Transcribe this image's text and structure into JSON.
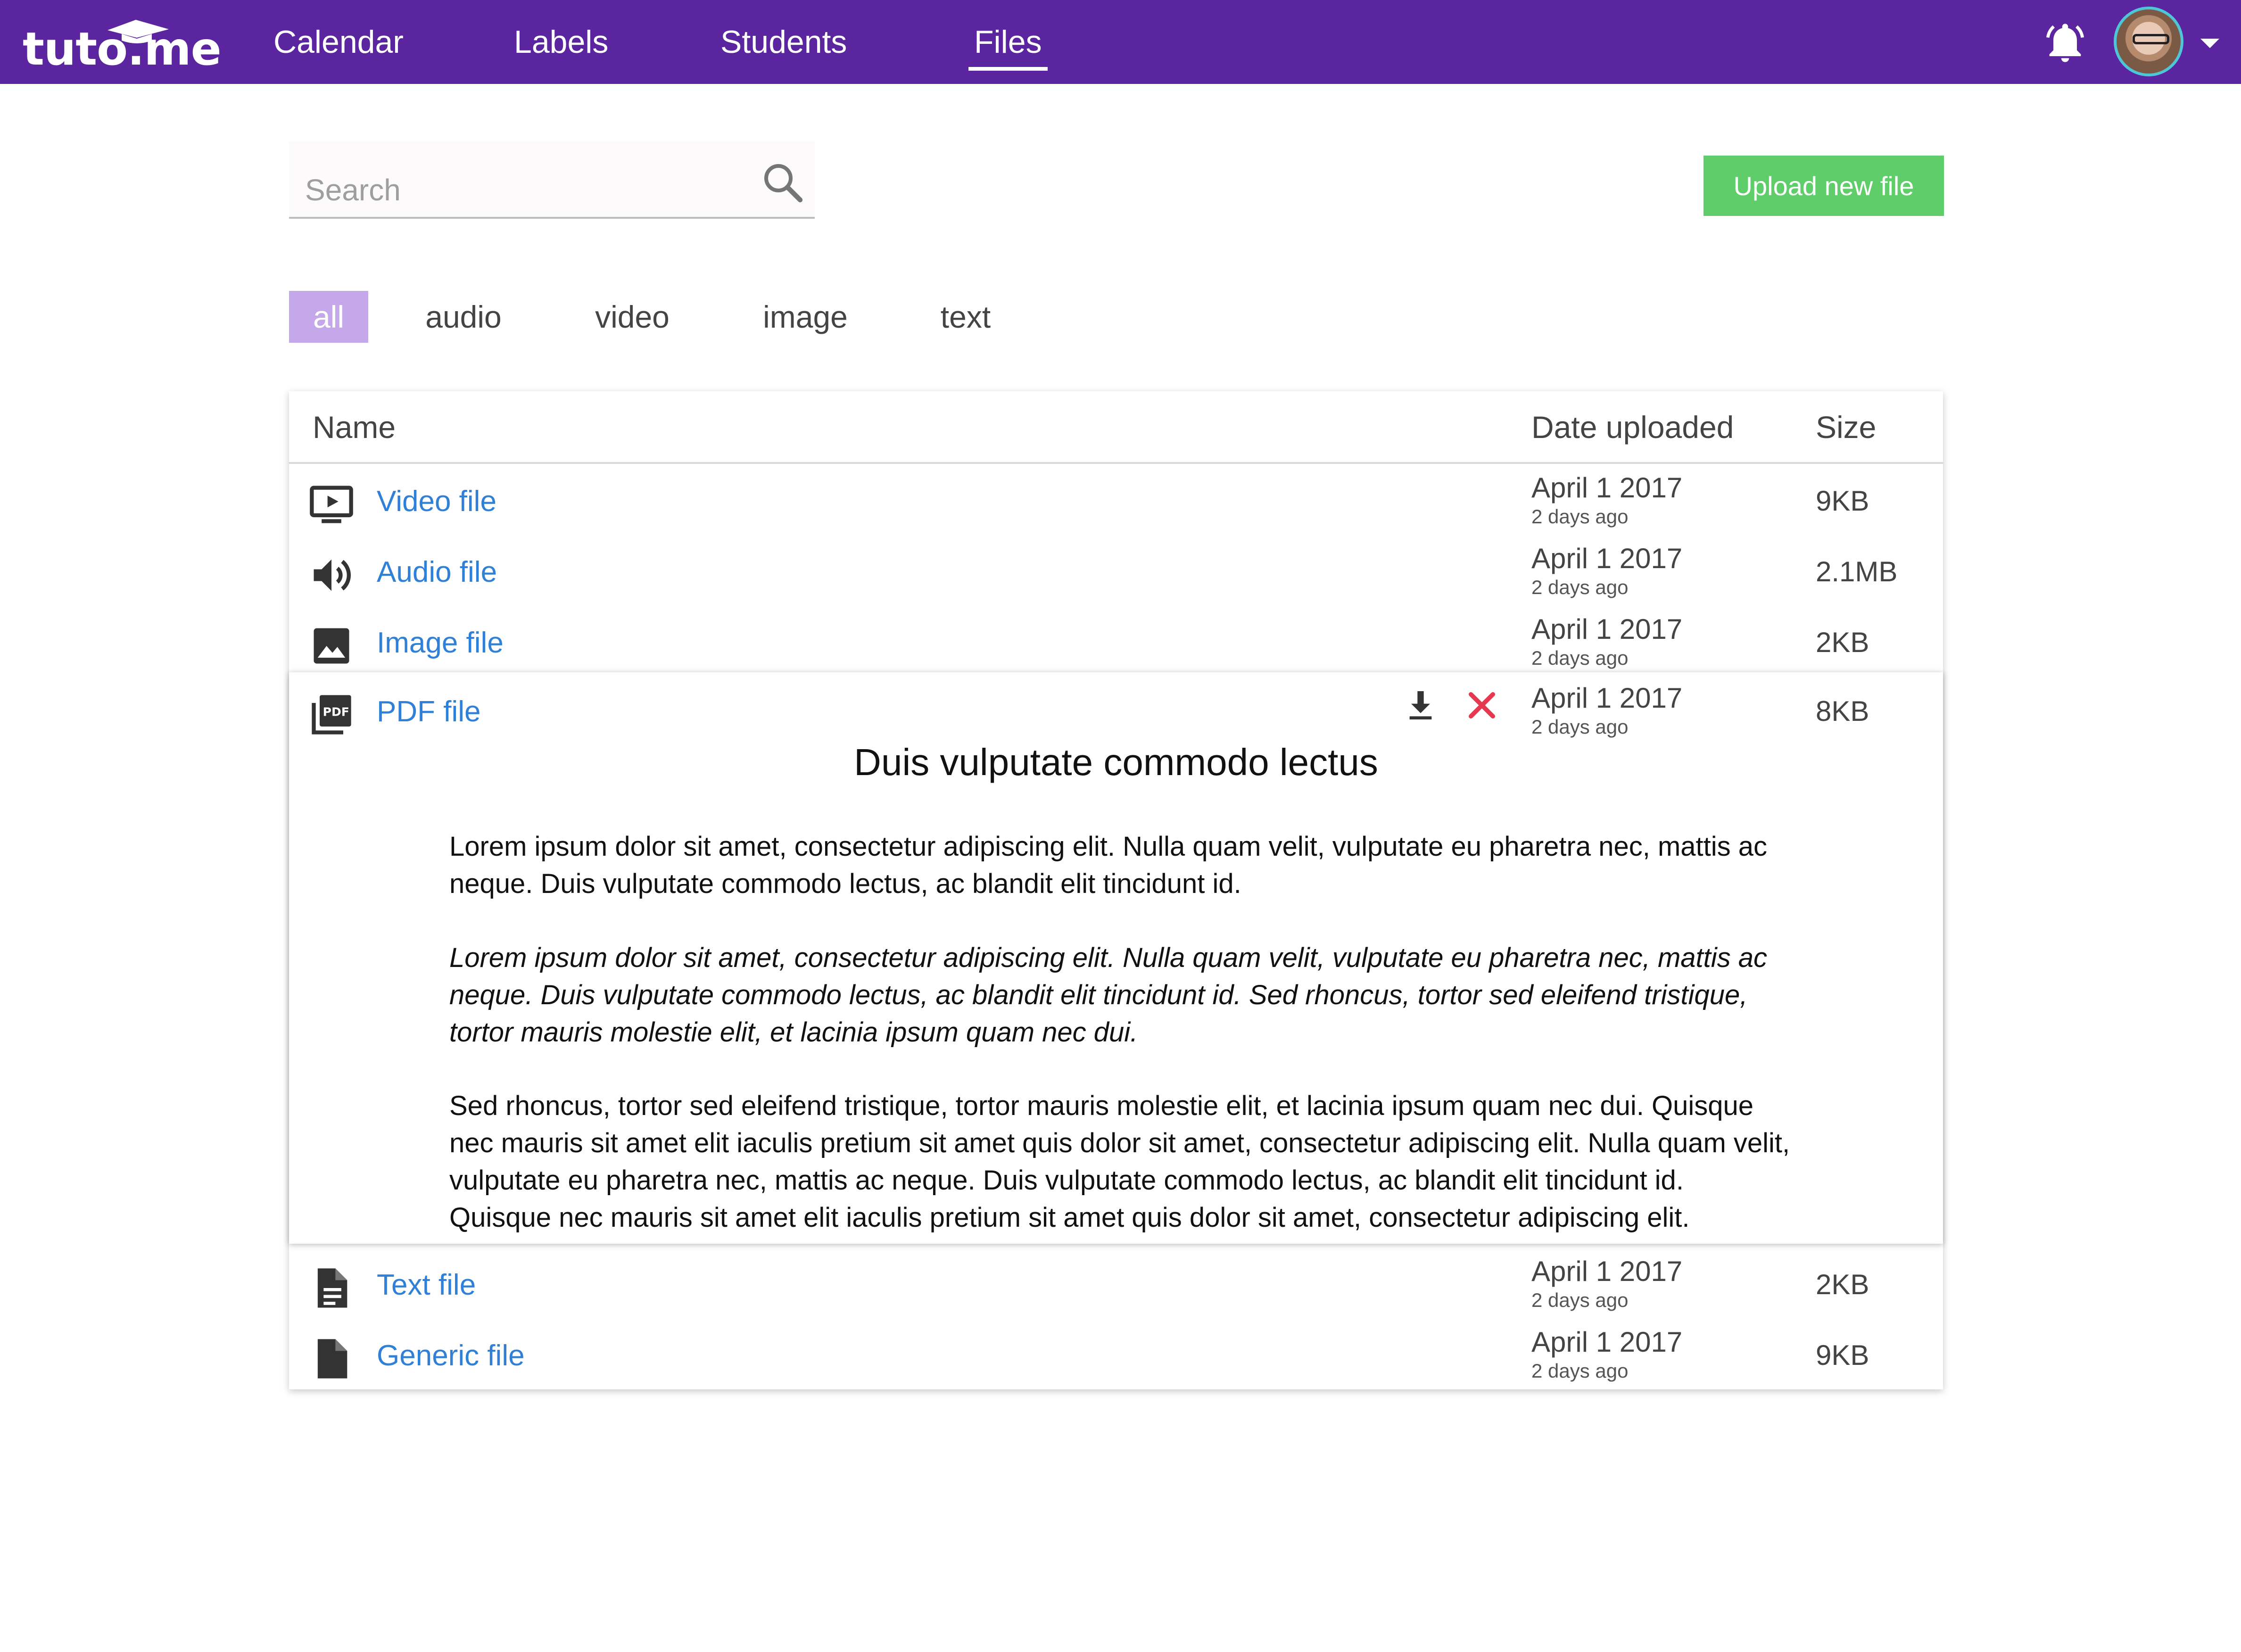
{
  "app": {
    "logo_text": "tuto.me"
  },
  "nav": {
    "items": [
      {
        "label": "Calendar"
      },
      {
        "label": "Labels"
      },
      {
        "label": "Students"
      },
      {
        "label": "Files",
        "active": true
      }
    ]
  },
  "header_icons": {
    "notifications": "bell-icon",
    "user_menu": "chevron-down-icon"
  },
  "search": {
    "placeholder": "Search",
    "value": ""
  },
  "toolbar": {
    "upload_label": "Upload new file"
  },
  "filters": [
    {
      "label": "all",
      "active": true
    },
    {
      "label": "audio"
    },
    {
      "label": "video"
    },
    {
      "label": "image"
    },
    {
      "label": "text"
    }
  ],
  "table": {
    "columns": [
      "Name",
      "Date uploaded",
      "Size"
    ],
    "rows": [
      {
        "icon": "video-file-icon",
        "name": "Video file",
        "date": "April 1 2017",
        "relative": "2 days ago",
        "size": "9KB"
      },
      {
        "icon": "audio-file-icon",
        "name": "Audio file",
        "date": "April 1 2017",
        "relative": "2 days ago",
        "size": "2.1MB"
      },
      {
        "icon": "image-file-icon",
        "name": "Image file",
        "date": "April 1 2017",
        "relative": "2 days ago",
        "size": "2KB"
      },
      {
        "icon": "pdf-file-icon",
        "name": "PDF file",
        "date": "April 1 2017",
        "relative": "2 days ago",
        "size": "8KB",
        "expanded": true
      },
      {
        "icon": "text-file-icon",
        "name": "Text file",
        "date": "April 1 2017",
        "relative": "2 days ago",
        "size": "2KB"
      },
      {
        "icon": "generic-file-icon",
        "name": "Generic file",
        "date": "April 1 2017",
        "relative": "2 days ago",
        "size": "9KB"
      }
    ]
  },
  "preview": {
    "title": "Duis vulputate commodo lectus",
    "paragraphs": [
      "Lorem ipsum dolor sit amet, consectetur adipiscing elit. Nulla quam velit, vulputate eu pharetra nec, mattis ac neque. Duis vulputate commodo lectus, ac blandit elit tincidunt id.",
      "Lorem ipsum dolor sit amet, consectetur adipiscing elit. Nulla quam velit, vulputate eu pharetra nec, mattis ac neque. Duis vulputate commodo lectus, ac blandit elit tincidunt id. Sed rhoncus, tortor sed eleifend tristique, tortor mauris molestie elit, et lacinia ipsum quam nec dui.",
      "Sed rhoncus, tortor sed eleifend tristique, tortor mauris molestie elit, et lacinia ipsum quam nec dui. Quisque nec mauris sit amet elit iaculis pretium sit amet quis dolor sit amet, consectetur adipiscing elit. Nulla quam velit, vulputate eu pharetra nec, mattis ac neque. Duis vulputate commodo lectus, ac blandit elit tincidunt id. Quisque nec mauris sit amet elit iaculis pretium sit amet quis dolor sit amet, consectetur adipiscing elit."
    ],
    "actions": {
      "download": "download-icon",
      "delete": "close-icon"
    }
  },
  "colors": {
    "header_bg": "#5a259e",
    "upload_button": "#5fce6a",
    "active_filter": "#c4a8ea",
    "link": "#2f80d6",
    "delete": "#e53950"
  }
}
